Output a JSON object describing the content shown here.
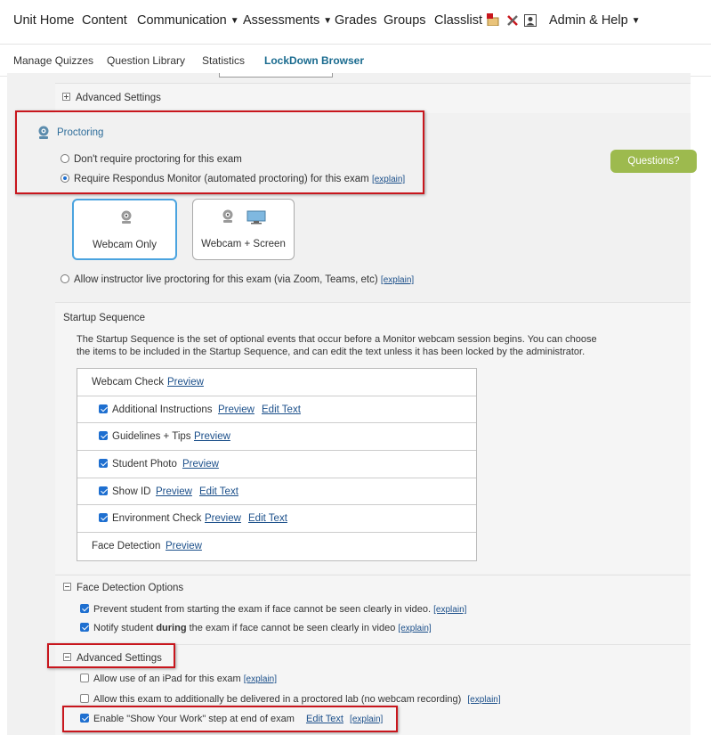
{
  "topnav": {
    "items": [
      "Unit Home",
      "Content",
      "Communication",
      "Assessments",
      "Grades",
      "Groups",
      "Classlist",
      "Admin & Help"
    ],
    "icons": [
      "mail-icon",
      "tools-icon",
      "user-box-icon"
    ]
  },
  "subnav": {
    "tabs": [
      "Manage Quizzes",
      "Question Library",
      "Statistics",
      "LockDown Browser"
    ],
    "active": "LockDown Browser"
  },
  "advanced_top": {
    "label": "Advanced Settings"
  },
  "proctoring": {
    "title": "Proctoring",
    "options": [
      "Don't require proctoring for this exam",
      "Require Respondus Monitor (automated proctoring) for this exam",
      "Allow instructor live proctoring for this exam (via Zoom, Teams, etc)"
    ],
    "explain": "[explain]",
    "questions_button": "Questions?",
    "cards": [
      "Webcam Only",
      "Webcam + Screen"
    ]
  },
  "startup": {
    "title": "Startup Sequence",
    "description_line1": "The Startup Sequence is the set of optional events that occur before a Monitor webcam session begins. You can choose",
    "description_line2": "the items to be included in the Startup Sequence, and can edit the text unless it has been locked by the administrator.",
    "rows": [
      {
        "label": "Webcam Check",
        "preview": "Preview",
        "edit": ""
      },
      {
        "label": "Additional Instructions",
        "preview": "Preview",
        "edit": "Edit Text"
      },
      {
        "label": "Guidelines + Tips",
        "preview": "Preview",
        "edit": ""
      },
      {
        "label": "Student Photo",
        "preview": "Preview",
        "edit": ""
      },
      {
        "label": "Show ID",
        "preview": "Preview",
        "edit": "Edit Text"
      },
      {
        "label": "Environment Check",
        "preview": "Preview",
        "edit": "Edit Text"
      },
      {
        "label": "Face Detection",
        "preview": "Preview",
        "edit": ""
      }
    ]
  },
  "face_detection": {
    "title": "Face Detection Options",
    "opt1": "Prevent student from starting the exam if face cannot be seen clearly in video.",
    "opt2_pre": "Notify student ",
    "opt2_bold": "during",
    "opt2_post": " the exam if face cannot be seen clearly in video"
  },
  "advanced": {
    "title": "Advanced Settings",
    "opt1": "Allow use of an iPad for this exam",
    "opt2": "Allow this exam to additionally be delivered in a proctored lab (no webcam recording)",
    "opt3": "Enable \"Show Your Work\" step at end of exam",
    "edit_text": "Edit Text"
  }
}
